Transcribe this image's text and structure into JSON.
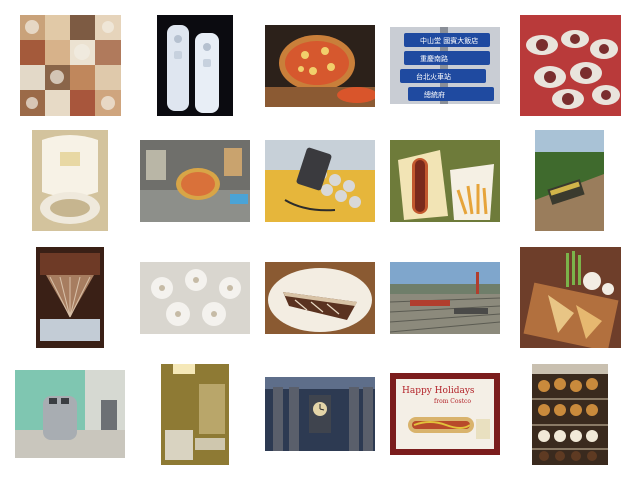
{
  "gallery": {
    "rows": 4,
    "columns": 5,
    "thumbnails": [
      {
        "subject": "food collage grid"
      },
      {
        "subject": "two white game remotes"
      },
      {
        "subject": "pizza on wooden board"
      },
      {
        "subject": "street direction signs"
      },
      {
        "subject": "table with many dishes"
      },
      {
        "subject": "toilet with open lid"
      },
      {
        "subject": "pizza on cluttered table"
      },
      {
        "subject": "phone on foam stand"
      },
      {
        "subject": "hot dog and fries"
      },
      {
        "subject": "train on tracks"
      },
      {
        "subject": "canopy bed"
      },
      {
        "subject": "white flower cake"
      },
      {
        "subject": "slice of pie"
      },
      {
        "subject": "rail yard aerial view"
      },
      {
        "subject": "plated food with flowers"
      },
      {
        "subject": "toaster in kitchen"
      },
      {
        "subject": "bathroom interior"
      },
      {
        "subject": "building clock"
      },
      {
        "subject": "hot dog on holiday tray"
      },
      {
        "subject": "donut display case"
      }
    ]
  },
  "photo_text": {
    "sign_line_1": "中山堂 國賓大飯店",
    "sign_line_2": "重慶南路",
    "sign_line_3": "台北火車站",
    "sign_line_4": "總統府",
    "tray_text_1": "Happy Holidays",
    "tray_text_2": "from Costco"
  }
}
